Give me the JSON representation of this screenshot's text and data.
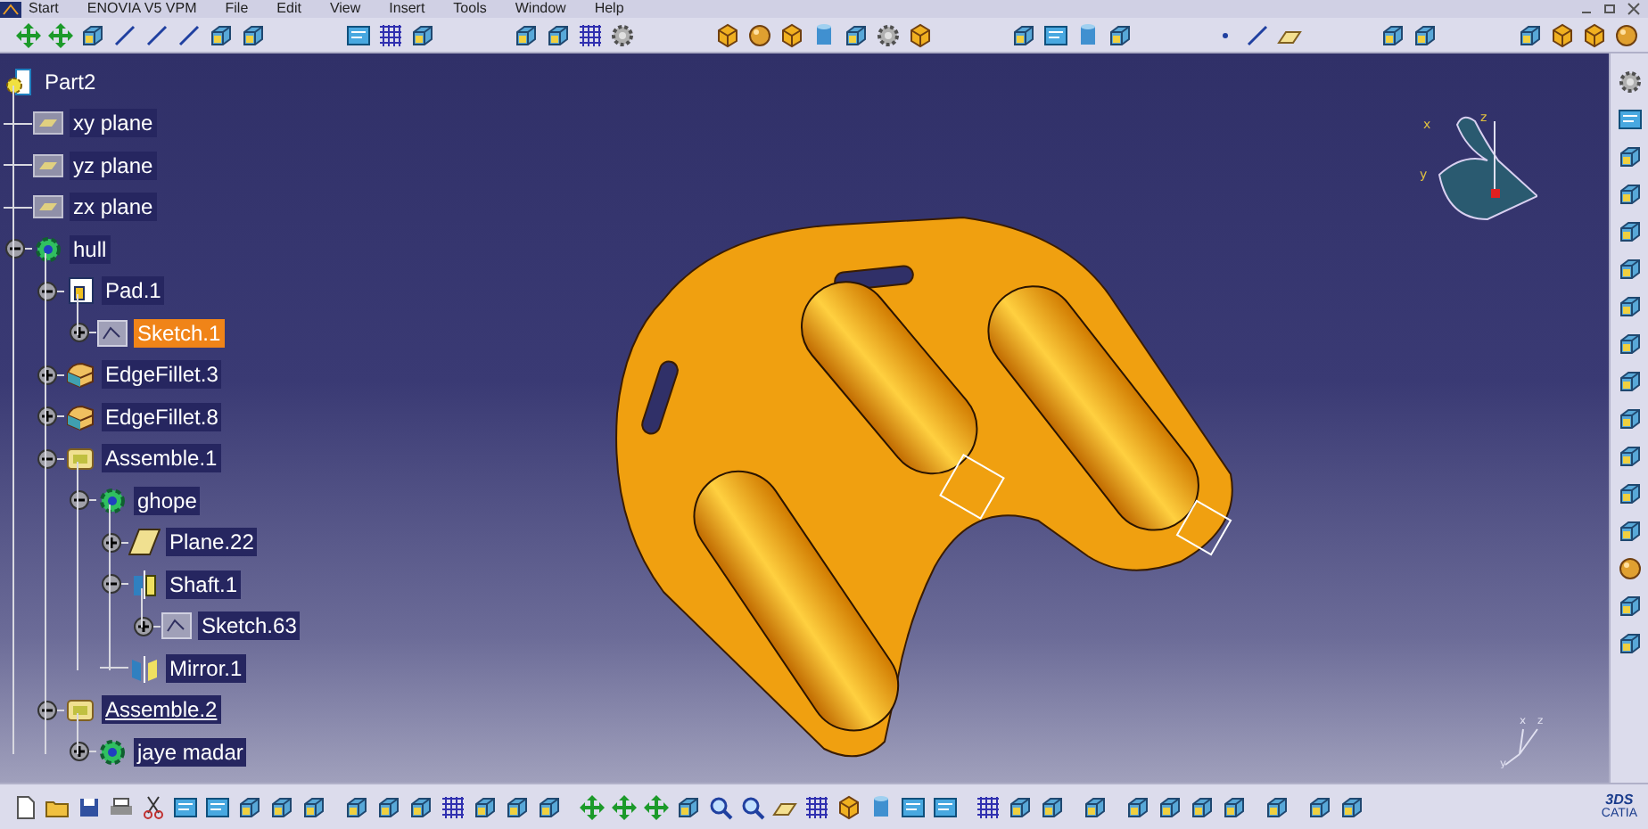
{
  "menu": [
    "Start",
    "ENOVIA V5 VPM",
    "File",
    "Edit",
    "View",
    "Insert",
    "Tools",
    "Window",
    "Help"
  ],
  "tree": {
    "label": "Part2",
    "kind": "part",
    "selected": false,
    "in_work": false,
    "children": [
      {
        "label": "xy plane",
        "kind": "plane",
        "selected": false,
        "in_work": false
      },
      {
        "label": "yz plane",
        "kind": "plane",
        "selected": false,
        "in_work": false
      },
      {
        "label": "zx plane",
        "kind": "plane",
        "selected": false,
        "in_work": false
      },
      {
        "label": "hull",
        "kind": "body",
        "selected": false,
        "in_work": false,
        "expanded": true,
        "children": [
          {
            "label": "Pad.1",
            "kind": "pad",
            "selected": false,
            "in_work": false,
            "expanded": true,
            "children": [
              {
                "label": "Sketch.1",
                "kind": "sketch",
                "selected": true,
                "in_work": false,
                "expanded": false
              }
            ]
          },
          {
            "label": "EdgeFillet.3",
            "kind": "fillet",
            "selected": false,
            "in_work": false,
            "expanded": false
          },
          {
            "label": "EdgeFillet.8",
            "kind": "fillet",
            "selected": false,
            "in_work": false,
            "expanded": false
          },
          {
            "label": "Assemble.1",
            "kind": "assemble",
            "selected": false,
            "in_work": false,
            "expanded": true,
            "children": [
              {
                "label": "ghope",
                "kind": "body",
                "selected": false,
                "in_work": false,
                "expanded": true,
                "children": [
                  {
                    "label": "Plane.22",
                    "kind": "planefeature",
                    "selected": false,
                    "in_work": false,
                    "expanded": false
                  },
                  {
                    "label": "Shaft.1",
                    "kind": "shaft",
                    "selected": false,
                    "in_work": false,
                    "expanded": true,
                    "children": [
                      {
                        "label": "Sketch.63",
                        "kind": "sketch",
                        "selected": false,
                        "in_work": false,
                        "expanded": false
                      }
                    ]
                  },
                  {
                    "label": "Mirror.1",
                    "kind": "mirror",
                    "selected": false,
                    "in_work": false
                  }
                ]
              }
            ]
          },
          {
            "label": "Assemble.2",
            "kind": "assemble",
            "selected": false,
            "in_work": true,
            "expanded": true,
            "children": [
              {
                "label": "jaye madar",
                "kind": "body",
                "selected": false,
                "in_work": false,
                "expanded": false
              }
            ]
          }
        ]
      }
    ]
  },
  "compass": {
    "labels": [
      "x",
      "z",
      "y"
    ]
  },
  "axis_triad": {
    "labels": [
      "x",
      "z",
      "y"
    ]
  },
  "logo": {
    "mark": "3DS",
    "name": "CATIA"
  }
}
